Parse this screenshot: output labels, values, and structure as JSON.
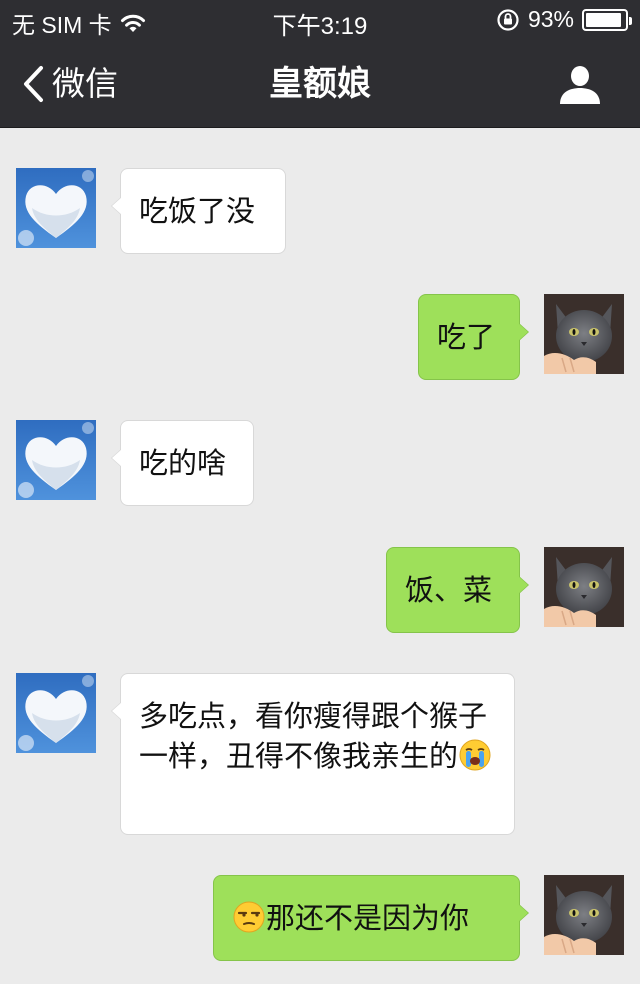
{
  "status_bar": {
    "carrier": "无 SIM 卡",
    "time": "下午3:19",
    "battery": "93%",
    "battery_level": 0.93,
    "icons": [
      "wifi-icon",
      "orientation-lock-icon",
      "battery-icon"
    ]
  },
  "nav": {
    "back_label": "微信",
    "title": "皇额娘",
    "icons": [
      "chevron-left-icon",
      "profile-icon"
    ]
  },
  "messages": [
    {
      "side": "in",
      "text": "吃饭了没",
      "avatar": "heart-cloud-avatar"
    },
    {
      "side": "out",
      "text": "吃了",
      "avatar": "gray-cat-avatar"
    },
    {
      "side": "in",
      "text": "吃的啥",
      "avatar": "heart-cloud-avatar"
    },
    {
      "side": "out",
      "text": "饭、菜",
      "avatar": "gray-cat-avatar"
    },
    {
      "side": "in",
      "text": "多吃点，看你瘦得跟个猴子一样，丑得不像我亲生的",
      "trailing_emoji": "crying-face-emoji",
      "avatar": "heart-cloud-avatar"
    },
    {
      "side": "out",
      "leading_emoji": "unamused-face-emoji",
      "text": "那还不是因为你",
      "avatar": "gray-cat-avatar"
    }
  ],
  "colors": {
    "bar_bg": "#2e2e32",
    "chat_bg": "#ebebeb",
    "outgoing_bubble": "#9ee05a",
    "incoming_bubble": "#ffffff"
  }
}
